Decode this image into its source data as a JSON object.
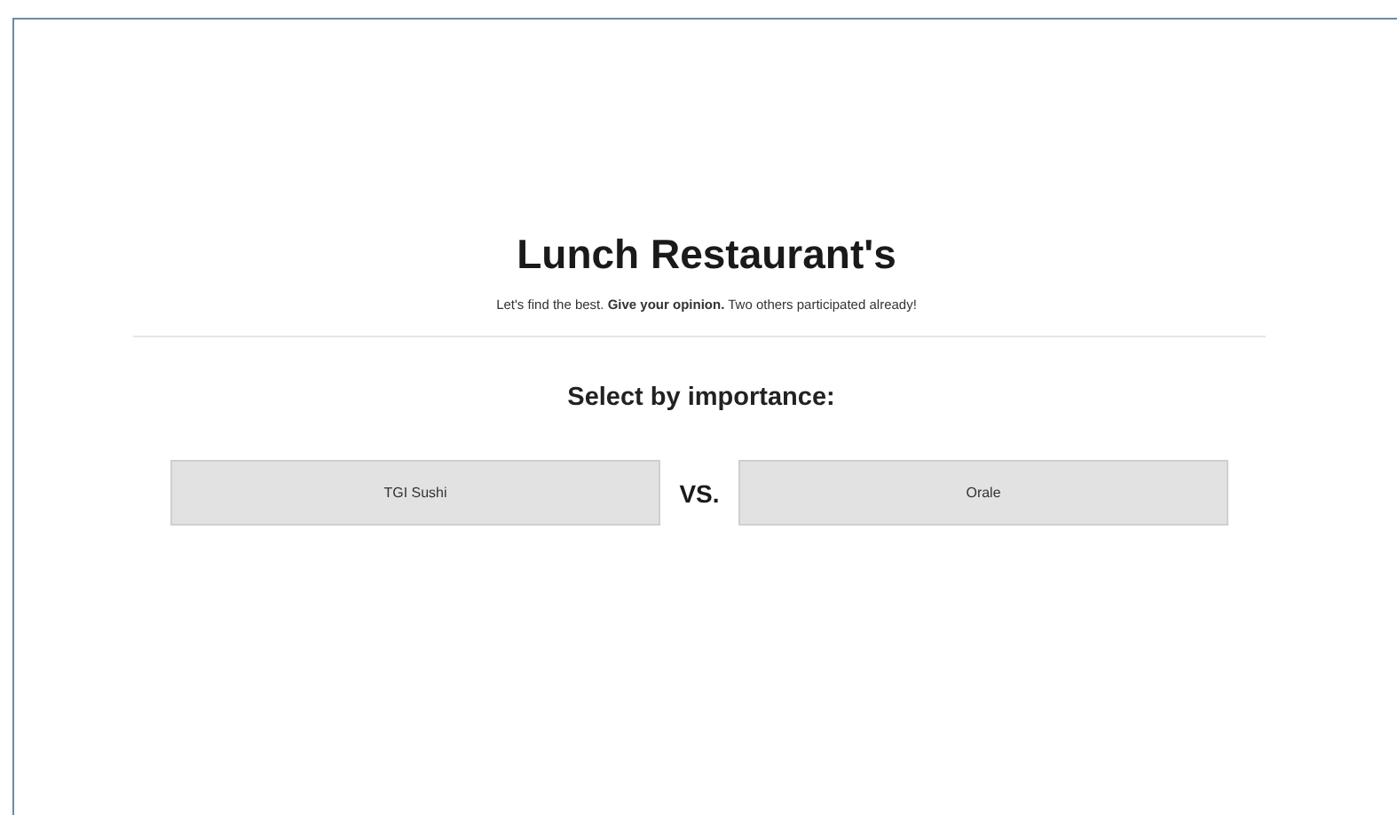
{
  "title": "Lunch Restaurant's",
  "subtitle": "Let's find the best. **Give your opinion.** Two others participated already!",
  "prompt": "Select by importance:",
  "options": [
    {
      "label": "TGI Sushi"
    },
    {
      "label": "Orale"
    }
  ],
  "separator": "VS."
}
